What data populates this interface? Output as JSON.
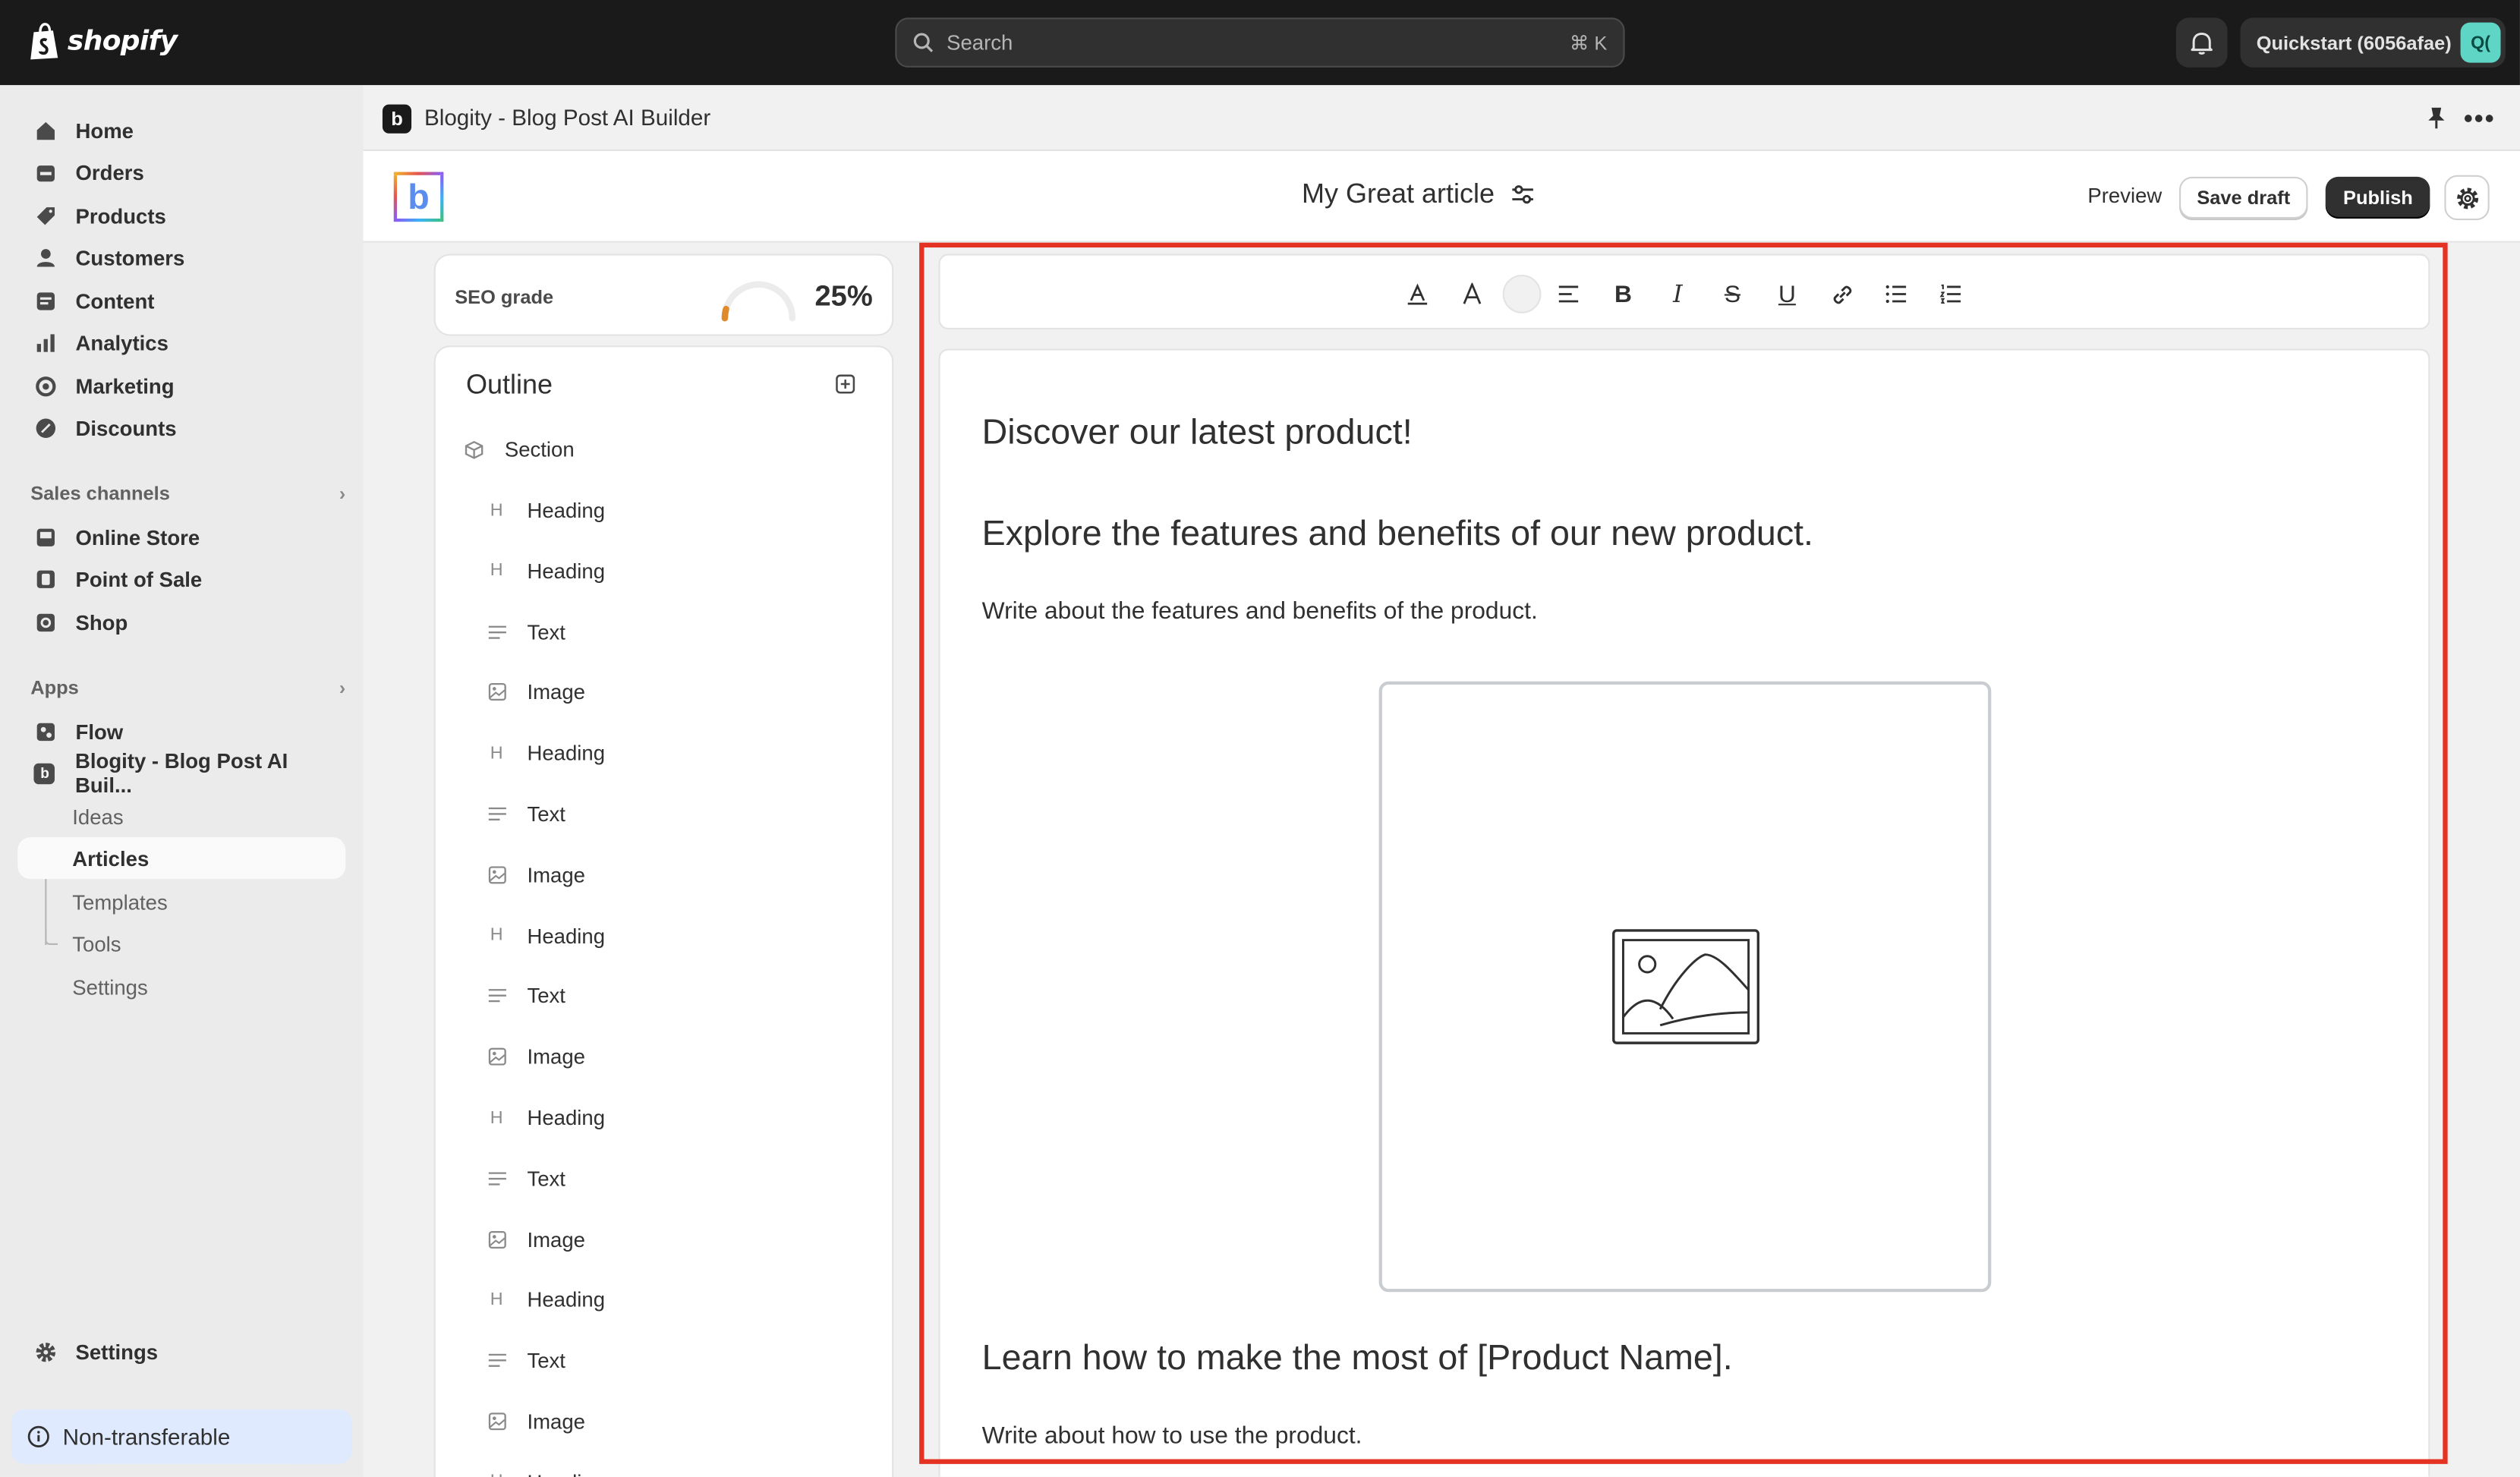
{
  "topbar": {
    "brand": "shopify",
    "search_placeholder": "Search",
    "search_shortcut": "⌘ K",
    "store_name": "Quickstart (6056afae)",
    "store_avatar": "Q("
  },
  "sidebar": {
    "main": [
      {
        "label": "Home",
        "icon": "home-icon"
      },
      {
        "label": "Orders",
        "icon": "orders-icon"
      },
      {
        "label": "Products",
        "icon": "tag-icon"
      },
      {
        "label": "Customers",
        "icon": "person-icon"
      },
      {
        "label": "Content",
        "icon": "content-icon"
      },
      {
        "label": "Analytics",
        "icon": "bar-chart-icon"
      },
      {
        "label": "Marketing",
        "icon": "target-icon"
      },
      {
        "label": "Discounts",
        "icon": "discount-icon"
      }
    ],
    "sales_channels_title": "Sales channels",
    "sales_channels": [
      {
        "label": "Online Store",
        "icon": "store-icon"
      },
      {
        "label": "Point of Sale",
        "icon": "pos-icon"
      },
      {
        "label": "Shop",
        "icon": "shop-icon"
      }
    ],
    "apps_title": "Apps",
    "apps": [
      {
        "label": "Flow",
        "icon": "flow-icon"
      },
      {
        "label": "Blogity - Blog Post AI Buil...",
        "icon": "blogity-icon"
      }
    ],
    "app_subitems": [
      "Ideas",
      "Articles",
      "Templates",
      "Tools",
      "Settings"
    ],
    "settings": "Settings",
    "non_transferable": "Non-transferable"
  },
  "app_header": {
    "icon_letter": "b",
    "title": "Blogity - Blog Post AI Builder"
  },
  "editor_header": {
    "logo_letter": "b",
    "doc_title": "My Great article",
    "preview": "Preview",
    "save_draft": "Save draft",
    "publish": "Publish"
  },
  "seo": {
    "label": "SEO grade",
    "percent": "25%",
    "value": 0.25,
    "accent": "#e08a2b"
  },
  "outline": {
    "title": "Outline",
    "section_label": "Section",
    "items": [
      "Heading",
      "Heading",
      "Text",
      "Image",
      "Heading",
      "Text",
      "Image",
      "Heading",
      "Text",
      "Image",
      "Heading",
      "Text",
      "Image",
      "Heading",
      "Text",
      "Image",
      "Heading"
    ]
  },
  "content": {
    "h1": "Discover our latest product!",
    "h2": "Explore the features and benefits of our new product.",
    "p1": "Write about the features and benefits of the product.",
    "h3": "Learn how to make the most of [Product Name].",
    "p2": "Write about how to use the product."
  },
  "colors": {
    "highlight": "#e53323",
    "topbar": "#1a1a1a",
    "publish": "#303030"
  }
}
